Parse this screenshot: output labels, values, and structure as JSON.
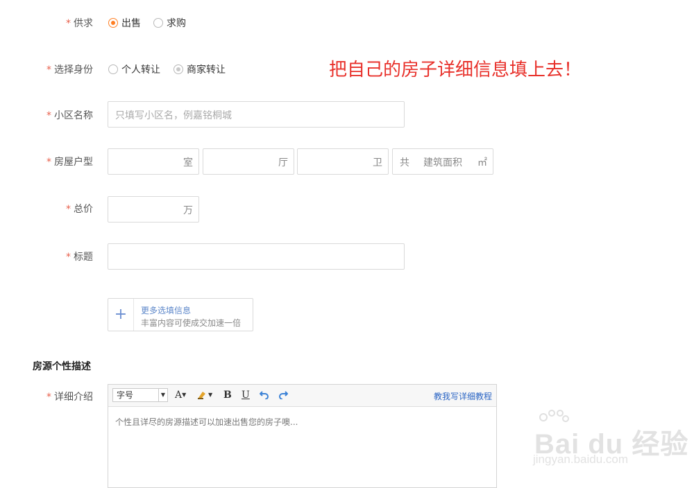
{
  "form": {
    "supply_demand": {
      "label": "供求",
      "required": "*",
      "options": [
        "出售",
        "求购"
      ],
      "selected": "出售"
    },
    "identity": {
      "label": "选择身份",
      "required": "*",
      "options": [
        "个人转让",
        "商家转让"
      ],
      "selected": "商家转让"
    },
    "community": {
      "label": "小区名称",
      "required": "*",
      "placeholder": "只填写小区名，例嘉铭桐城"
    },
    "house_type": {
      "label": "房屋户型",
      "required": "*",
      "units": [
        "室",
        "厅",
        "卫"
      ],
      "area_prefix": "共",
      "area_placeholder": "建筑面积",
      "area_unit": "㎡"
    },
    "total_price": {
      "label": "总价",
      "required": "*",
      "unit": "万"
    },
    "title": {
      "label": "标题",
      "required": "*"
    },
    "more_options": {
      "title": "更多选填信息",
      "subtitle": "丰富内容可使成交加速一倍",
      "icon": "plus-icon"
    }
  },
  "annotation": "把自己的房子详细信息填上去！",
  "description_section": {
    "heading": "房源个性描述",
    "detail": {
      "label": "详细介绍",
      "required": "*",
      "toolbar": {
        "font_size": "字号",
        "font_color": "A",
        "bold": "B",
        "underline": "U",
        "tutorial_link": "教我写详细教程"
      },
      "placeholder": "个性且详尽的房源描述可以加速出售您的房子噢..."
    }
  },
  "watermark": {
    "brand": "Bai du 经验",
    "url": "jingyan.baidu.com"
  },
  "colors": {
    "required": "#e8604c",
    "radio_selected": "#ff7f24",
    "annotation": "#e8312b",
    "link": "#2b65c4"
  }
}
